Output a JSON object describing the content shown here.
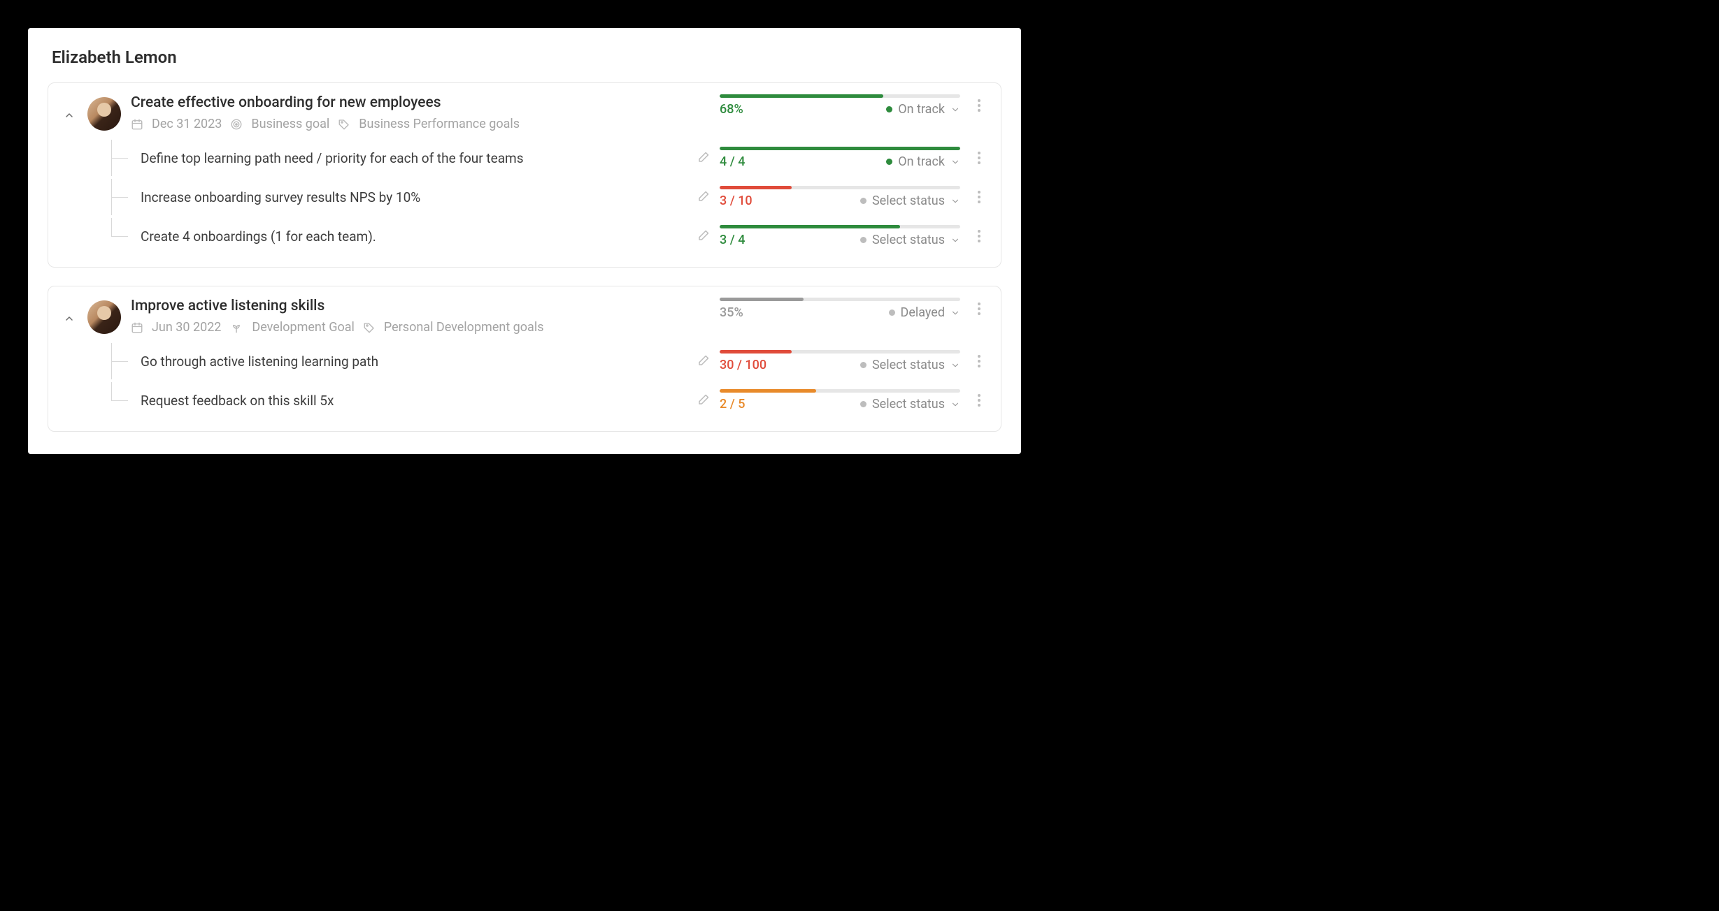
{
  "person_name": "Elizabeth Lemon",
  "goals": [
    {
      "title": "Create effective onboarding for new employees",
      "date": "Dec 31 2023",
      "goal_type": "Business goal",
      "category": "Business Performance goals",
      "progress_label": "68%",
      "progress_pct": 68,
      "progress_color": "green",
      "status_label": "On track",
      "status_dot": "green",
      "krs": [
        {
          "title": "Define top learning path need / priority for each of the four teams",
          "value": "4 / 4",
          "pct": 100,
          "color": "green",
          "status": "On track",
          "dot": "green"
        },
        {
          "title": "Increase onboarding survey results NPS by 10%",
          "value": "3 / 10",
          "pct": 30,
          "color": "red",
          "status": "Select status",
          "dot": "gray"
        },
        {
          "title": "Create 4 onboardings (1 for each team).",
          "value": "3 / 4",
          "pct": 75,
          "color": "green",
          "status": "Select status",
          "dot": "gray"
        }
      ]
    },
    {
      "title": "Improve active listening skills",
      "date": "Jun 30 2022",
      "goal_type": "Development Goal",
      "category": "Personal Development goals",
      "progress_label": "35%",
      "progress_pct": 35,
      "progress_color": "gray",
      "status_label": "Delayed",
      "status_dot": "gray",
      "krs": [
        {
          "title": "Go through active listening learning path",
          "value": "30 / 100",
          "pct": 30,
          "color": "red",
          "status": "Select status",
          "dot": "gray"
        },
        {
          "title": "Request feedback on this skill 5x",
          "value": "2 / 5",
          "pct": 40,
          "color": "orange",
          "status": "Select status",
          "dot": "gray"
        }
      ]
    }
  ]
}
